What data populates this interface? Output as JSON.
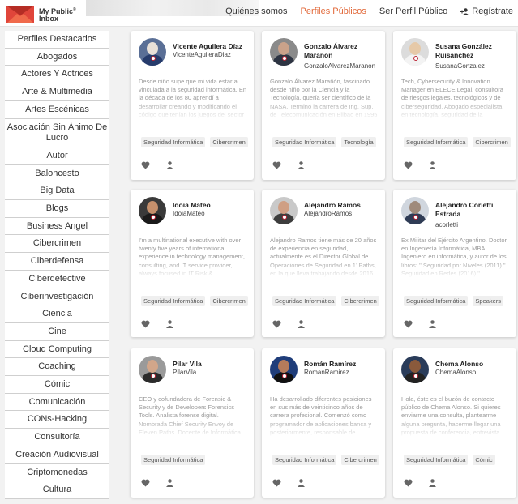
{
  "brand": {
    "line1": "My Public",
    "line2": "Inbox",
    "mark": "®"
  },
  "nav": {
    "items": [
      "Quiénes somos",
      "Perfiles Públicos",
      "Ser Perfil Público"
    ],
    "register": "Regístrate",
    "active_index": 1
  },
  "colors": {
    "accent": "#e2693a",
    "logo": "#e0453a"
  },
  "categories": [
    "Perfiles Destacados",
    "Abogados",
    "Actores Y Actrices",
    "Arte & Multimedia",
    "Artes Escénicas",
    "Asociación Sin Ánimo De Lucro",
    "Autor",
    "Baloncesto",
    "Big Data",
    "Blogs",
    "Business Angel",
    "Cibercrimen",
    "Ciberdefensa",
    "Ciberdetective",
    "Ciberinvestigación",
    "Ciencia",
    "Cine",
    "Cloud Computing",
    "Coaching",
    "Cómic",
    "Comunicación",
    "CONs-Hacking",
    "Consultoría",
    "Creación Audiovisual",
    "Criptomonedas",
    "Cultura"
  ],
  "profiles": [
    {
      "name": "Vicente Aguilera Díaz",
      "user": "VicenteAguileraDiaz",
      "bio": "Desde niño supe que mi vida estaría vinculada a la seguridad informática. En la década de los 80 aprendí a desarrollar creando y modificando el código que tenían los juegos del sector",
      "tags": [
        "Seguridad Informática",
        "Cibercrimen"
      ]
    },
    {
      "name": "Gonzalo Álvarez Marañon",
      "user": "GonzaloAlvarezMaranon",
      "bio": "Gonzalo Álvarez Marañón, fascinado desde niño por la Ciencia y la Tecnología, quería ser científico de la NASA. Terminó la carrera de Ing. Sup. de Telecomunicación en Bilbao en 1995",
      "tags": [
        "Seguridad Informática",
        "Tecnología"
      ]
    },
    {
      "name": "Susana González Ruisánchez",
      "user": "SusanaGonzalez",
      "bio": "Tech, Cybersecurity & Innovation Manager en ELECE Legal, consultora de riesgos legales, tecnológicos y de ciberseguridad. Abogado especialista en tecnología, seguridad de la información",
      "tags": [
        "Seguridad Informática",
        "Cibercrimen"
      ]
    },
    {
      "name": "Idoia Mateo",
      "user": "IdoiaMateo",
      "bio": "I'm a multinational executive with over twenty five years of international experience in technology management, consulting, and IT service provider, always focused in IT Risk & Cybersecurity",
      "tags": [
        "Seguridad Informática",
        "Cibercrimen"
      ]
    },
    {
      "name": "Alejandro Ramos",
      "user": "AlejandroRamos",
      "bio": "Alejandro Ramos tiene más de 20 años de experiencia en seguridad, actualmente es el Director Global de Operaciones de Seguridad en 11Paths, en la que lleva trabajando desde 2016 Anteriormente",
      "tags": [
        "Seguridad Informática",
        "Cibercrimen"
      ]
    },
    {
      "name": "Alejandro Corletti Estrada",
      "user": "acorletti",
      "bio": "Ex Militar del Ejército Argentino. Doctor en Ingeniería Informática, MBA, Ingeniero en informática, y autor de los libros: \" Seguridad por Niveles (2011) \" Seguridad en Redes (2016) \" Ciberseguridad",
      "tags": [
        "Seguridad Informática",
        "Speakers"
      ]
    },
    {
      "name": "Pilar Vila",
      "user": "PilarVila",
      "bio": "CEO y cofundadora de Forensic & Security y de Developers Forensics Tools. Analista forense digital. Nombrada Chief Security Envoy de Eleven Paths. Docente de Informática Forense en diferentes",
      "tags": [
        "Seguridad Informática"
      ]
    },
    {
      "name": "Román Ramírez",
      "user": "RomanRamirez",
      "bio": "Ha desarrollado diferentes posiciones en sus más de veinticinco años de carrera profesional. Comenzó como programador de aplicaciones banca y posteriormente, responsable de sistemas",
      "tags": [
        "Seguridad Informática",
        "Cibercrimen"
      ]
    },
    {
      "name": "Chema Alonso",
      "user": "ChemaAlonso",
      "bio": "Hola, éste es el buzón de contacto público de Chema Alonso. Si quieres enviarme una consulta, plantearme alguna pregunta, hacerme llegar una propuesta de conferencia, entrevista",
      "tags": [
        "Seguridad Informática",
        "Cómic"
      ]
    }
  ],
  "icons": {
    "like": "heart-icon",
    "follow": "person-icon",
    "register": "add-user-icon"
  }
}
